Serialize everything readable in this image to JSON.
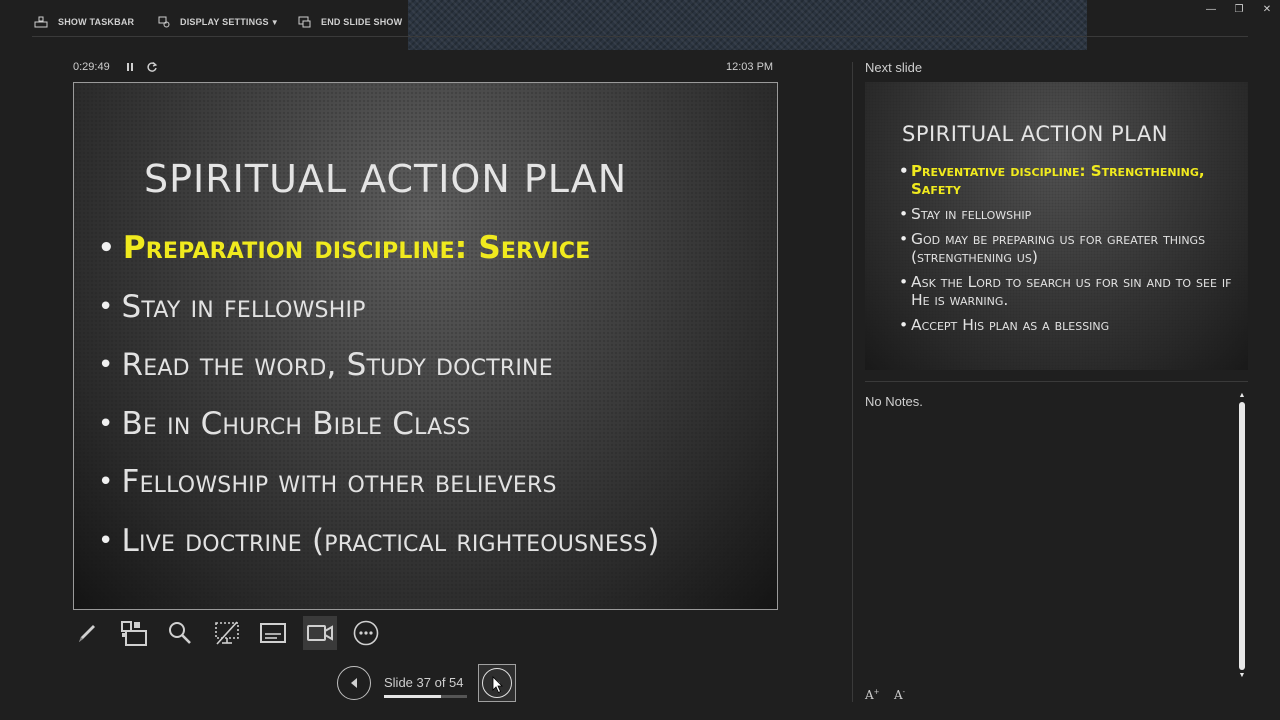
{
  "toolbar": {
    "show_taskbar": "SHOW TASKBAR",
    "display_settings": "DISPLAY SETTINGS",
    "end_slide_show": "END SLIDE SHOW"
  },
  "timer": {
    "elapsed": "0:29:49",
    "clock": "12:03 PM"
  },
  "current_slide": {
    "title": "SPIRITUAL ACTION PLAN",
    "bullets": [
      {
        "text": "Preparation discipline: Service",
        "highlight": true
      },
      {
        "text": "Stay in fellowship",
        "highlight": false
      },
      {
        "text": "Read the word, Study doctrine",
        "highlight": false
      },
      {
        "text": "Be in Church Bible Class",
        "highlight": false
      },
      {
        "text": "Fellowship with other believers",
        "highlight": false
      },
      {
        "text": "Live doctrine (practical righteousness)",
        "highlight": false
      }
    ],
    "highlight_color": "#f0ea1e"
  },
  "tools": [
    {
      "icon": "pen-icon"
    },
    {
      "icon": "see-all-slides-icon"
    },
    {
      "icon": "zoom-icon"
    },
    {
      "icon": "black-screen-icon"
    },
    {
      "icon": "subtitles-icon"
    },
    {
      "icon": "camera-icon"
    },
    {
      "icon": "more-options-icon"
    }
  ],
  "navigation": {
    "slide_counter": "Slide 37 of 54",
    "current": 37,
    "total": 54
  },
  "next_slide": {
    "label": "Next slide",
    "title": "SPIRITUAL ACTION PLAN",
    "bullets": [
      {
        "text": "Preventative discipline: Strengthening, Safety",
        "highlight": true
      },
      {
        "text": "Stay in fellowship",
        "highlight": false
      },
      {
        "text": "God may be preparing us for greater things (strengthening us)",
        "highlight": false
      },
      {
        "text": "Ask the Lord to search us for sin and to see if He is warning.",
        "highlight": false
      },
      {
        "text": "Accept His plan as a blessing",
        "highlight": false
      }
    ]
  },
  "notes": {
    "text": "No Notes."
  }
}
